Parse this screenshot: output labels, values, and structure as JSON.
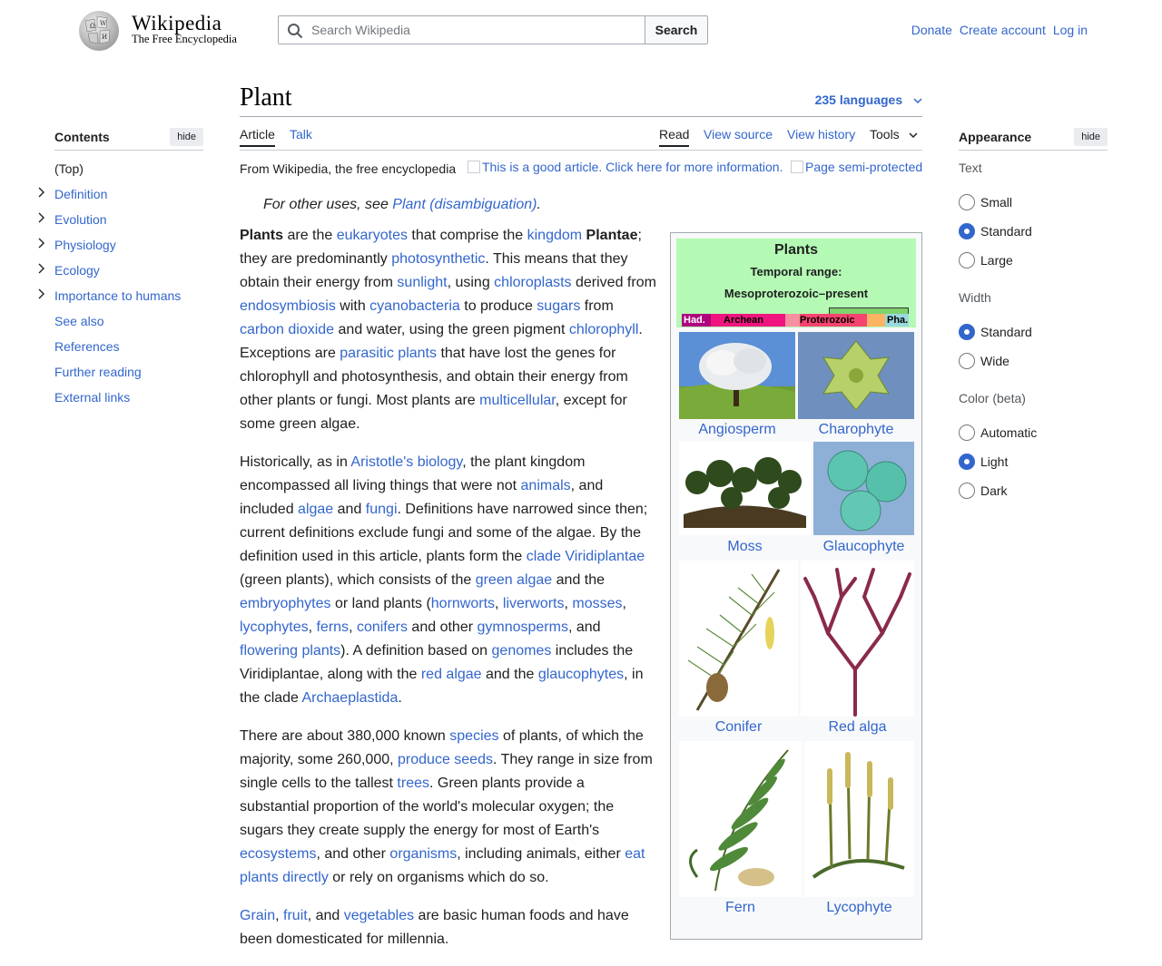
{
  "header": {
    "wordmark": "Wikipedia",
    "tagline": "The Free Encyclopedia",
    "search_placeholder": "Search Wikipedia",
    "search_button": "Search",
    "links": [
      "Donate",
      "Create account",
      "Log in"
    ]
  },
  "toc": {
    "title": "Contents",
    "hide": "hide",
    "items": [
      {
        "label": "(Top)",
        "expandable": false
      },
      {
        "label": "Definition",
        "expandable": true
      },
      {
        "label": "Evolution",
        "expandable": true
      },
      {
        "label": "Physiology",
        "expandable": true
      },
      {
        "label": "Ecology",
        "expandable": true
      },
      {
        "label": "Importance to humans",
        "expandable": true
      },
      {
        "label": "See also",
        "expandable": false
      },
      {
        "label": "References",
        "expandable": false
      },
      {
        "label": "Further reading",
        "expandable": false
      },
      {
        "label": "External links",
        "expandable": false
      }
    ]
  },
  "article": {
    "title": "Plant",
    "languages": "235 languages",
    "tabs": {
      "article": "Article",
      "talk": "Talk",
      "read": "Read",
      "view_source": "View source",
      "view_history": "View history",
      "tools": "Tools"
    },
    "from": "From Wikipedia, the free encyclopedia",
    "good_article": "This is a good article. Click here for more information.",
    "semi_protected": "Page semi-protected",
    "hatnote_prefix": "For other uses, see ",
    "hatnote_link": "Plant (disambiguation)",
    "hatnote_suffix": "."
  },
  "infobox": {
    "title": "Plants",
    "range_label": "Temporal range:",
    "range_value": "Mesoproterozoic–present",
    "timeline": [
      "Had.",
      "Archean",
      "Proterozoic",
      "Pha."
    ],
    "captions": [
      "Angiosperm",
      "Charophyte",
      "Moss",
      "Glaucophyte",
      "Conifer",
      "Red alga",
      "Fern",
      "Lycophyte"
    ]
  },
  "appearance": {
    "title": "Appearance",
    "hide": "hide",
    "text_label": "Text",
    "text_options": [
      "Small",
      "Standard",
      "Large"
    ],
    "text_selected": "Standard",
    "width_label": "Width",
    "width_options": [
      "Standard",
      "Wide"
    ],
    "width_selected": "Standard",
    "color_label": "Color (beta)",
    "color_options": [
      "Automatic",
      "Light",
      "Dark"
    ],
    "color_selected": "Light"
  },
  "paragraphs": [
    [
      {
        "t": "Plants",
        "b": true
      },
      {
        "t": " are the "
      },
      {
        "t": "eukaryotes",
        "l": true
      },
      {
        "t": " that comprise the "
      },
      {
        "t": "kingdom",
        "l": true
      },
      {
        "t": " "
      },
      {
        "t": "Plantae",
        "b": true
      },
      {
        "t": "; they are predominantly "
      },
      {
        "t": "photosynthetic",
        "l": true
      },
      {
        "t": ". This means that they obtain their energy from "
      },
      {
        "t": "sunlight",
        "l": true
      },
      {
        "t": ", using "
      },
      {
        "t": "chloroplasts",
        "l": true
      },
      {
        "t": " derived from "
      },
      {
        "t": "endosymbiosis",
        "l": true
      },
      {
        "t": " with "
      },
      {
        "t": "cyanobacteria",
        "l": true
      },
      {
        "t": " to produce "
      },
      {
        "t": "sugars",
        "l": true
      },
      {
        "t": " from "
      },
      {
        "t": "carbon dioxide",
        "l": true
      },
      {
        "t": " and water, using the green pigment "
      },
      {
        "t": "chlorophyll",
        "l": true
      },
      {
        "t": ". Exceptions are "
      },
      {
        "t": "parasitic plants",
        "l": true
      },
      {
        "t": " that have lost the genes for chlorophyll and photosynthesis, and obtain their energy from other plants or fungi. Most plants are "
      },
      {
        "t": "multicellular",
        "l": true
      },
      {
        "t": ", except for some green algae."
      }
    ],
    [
      {
        "t": "Historically, as in "
      },
      {
        "t": "Aristotle's biology",
        "l": true
      },
      {
        "t": ", the plant kingdom encompassed all living things that were not "
      },
      {
        "t": "animals",
        "l": true
      },
      {
        "t": ", and included "
      },
      {
        "t": "algae",
        "l": true
      },
      {
        "t": " and "
      },
      {
        "t": "fungi",
        "l": true
      },
      {
        "t": ". Definitions have narrowed since then; current definitions exclude fungi and some of the algae. By the definition used in this article, plants form the "
      },
      {
        "t": "clade",
        "l": true
      },
      {
        "t": " "
      },
      {
        "t": "Viridiplantae",
        "l": true
      },
      {
        "t": " (green plants), which consists of the "
      },
      {
        "t": "green algae",
        "l": true
      },
      {
        "t": " and the "
      },
      {
        "t": "embryophytes",
        "l": true
      },
      {
        "t": " or land plants ("
      },
      {
        "t": "hornworts",
        "l": true
      },
      {
        "t": ", "
      },
      {
        "t": "liverworts",
        "l": true
      },
      {
        "t": ", "
      },
      {
        "t": "mosses",
        "l": true
      },
      {
        "t": ", "
      },
      {
        "t": "lycophytes",
        "l": true
      },
      {
        "t": ", "
      },
      {
        "t": "ferns",
        "l": true
      },
      {
        "t": ", "
      },
      {
        "t": "conifers",
        "l": true
      },
      {
        "t": " and other "
      },
      {
        "t": "gymnosperms",
        "l": true
      },
      {
        "t": ", and "
      },
      {
        "t": "flowering plants",
        "l": true
      },
      {
        "t": "). A definition based on "
      },
      {
        "t": "genomes",
        "l": true
      },
      {
        "t": " includes the Viridiplantae, along with the "
      },
      {
        "t": "red algae",
        "l": true
      },
      {
        "t": " and the "
      },
      {
        "t": "glaucophytes",
        "l": true
      },
      {
        "t": ", in the clade "
      },
      {
        "t": "Archaeplastida",
        "l": true
      },
      {
        "t": "."
      }
    ],
    [
      {
        "t": "There are about 380,000 known "
      },
      {
        "t": "species",
        "l": true
      },
      {
        "t": " of plants, of which the majority, some 260,000, "
      },
      {
        "t": "produce seeds",
        "l": true
      },
      {
        "t": ". They range in size from single cells to the tallest "
      },
      {
        "t": "trees",
        "l": true
      },
      {
        "t": ". Green plants provide a substantial proportion of the world's molecular oxygen; the sugars they create supply the energy for most of Earth's "
      },
      {
        "t": "ecosystems",
        "l": true
      },
      {
        "t": ", and other "
      },
      {
        "t": "organisms",
        "l": true
      },
      {
        "t": ", including animals, either "
      },
      {
        "t": "eat plants directly",
        "l": true
      },
      {
        "t": " or rely on organisms which do so."
      }
    ],
    [
      {
        "t": "Grain",
        "l": true
      },
      {
        "t": ", "
      },
      {
        "t": "fruit",
        "l": true
      },
      {
        "t": ", and "
      },
      {
        "t": "vegetables",
        "l": true
      },
      {
        "t": " are basic human foods and have been domesticated for millennia."
      }
    ]
  ]
}
